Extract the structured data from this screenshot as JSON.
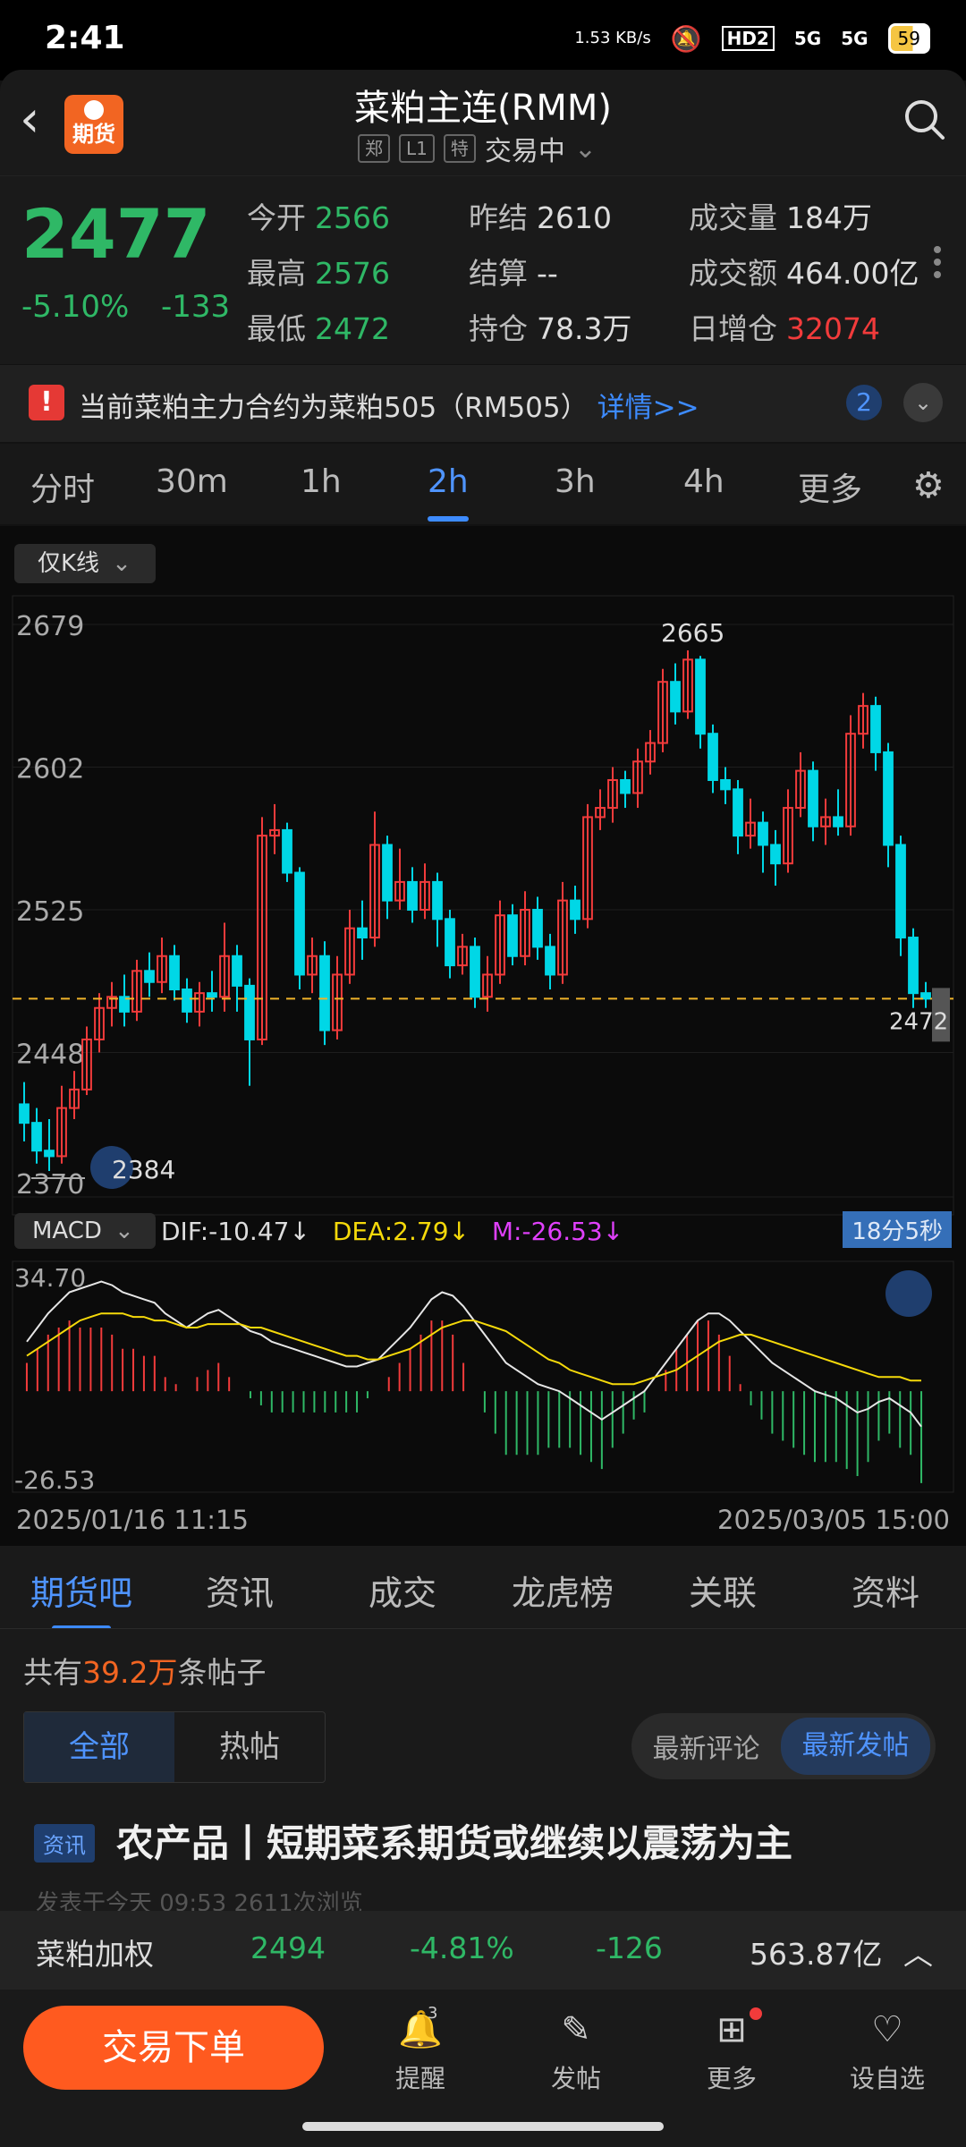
{
  "status_bar": {
    "time": "2:41",
    "net_speed": "1.53 KB/s",
    "hd": "HD2",
    "sig1": "5G",
    "sig2": "5G",
    "battery": "59"
  },
  "header": {
    "title": "菜粕主连(RMM)",
    "tag1": "郑",
    "tag2": "L1",
    "tag3": "特",
    "status": "交易中",
    "logo_text": "期货"
  },
  "quote": {
    "price": "2477",
    "pct": "-5.10%",
    "change": "-133",
    "open_label": "今开",
    "open": "2566",
    "prev_label": "昨结",
    "prev": "2610",
    "vol_label": "成交量",
    "vol": "184万",
    "high_label": "最高",
    "high": "2576",
    "settle_label": "结算",
    "settle": "--",
    "amount_label": "成交额",
    "amount": "464.00亿",
    "low_label": "最低",
    "low": "2472",
    "oi_label": "持仓",
    "oi": "78.3万",
    "oi_inc_label": "日增仓",
    "oi_inc": "32074"
  },
  "notice": {
    "text": "当前菜粕主力合约为菜粕505（RM505）",
    "link": "详情>>",
    "count": "2"
  },
  "periods": [
    "分时",
    "30m",
    "1h",
    "2h",
    "3h",
    "4h",
    "更多"
  ],
  "active_period": "2h",
  "chart_controls": {
    "kline_select": "仅K线",
    "macd_select": "MACD",
    "time_badge": "18分5秒",
    "start_date": "2025/01/16 11:15",
    "end_date": "2025/03/05 15:00"
  },
  "macd": {
    "dif": "DIF:-10.47↓",
    "dea": "DEA:2.79↓",
    "m": "M:-26.53↓"
  },
  "section_tabs": [
    "期货吧",
    "资讯",
    "成交",
    "龙虎榜",
    "关联",
    "资料"
  ],
  "posts": {
    "count_prefix": "共有",
    "count": "39.2万",
    "count_suffix": "条帖子",
    "seg_all": "全部",
    "seg_hot": "热帖",
    "sort_comment": "最新评论",
    "sort_post": "最新发帖"
  },
  "news": {
    "tag": "资讯",
    "title": "农产品丨短期菜系期货或继续以震荡为主",
    "meta": "发表于今天 09:53    2611次浏览"
  },
  "weighted": {
    "name": "菜粕加权",
    "price": "2494",
    "pct": "-4.81%",
    "change": "-126",
    "amount": "563.87亿"
  },
  "bottom": {
    "trade": "交易下单",
    "remind": "提醒",
    "remind_badge": "3",
    "post": "发帖",
    "more": "更多",
    "watch": "设自选"
  },
  "colors": {
    "up": "#f23b3b",
    "down": "#00d7e6",
    "accent": "#3d8bff",
    "orange": "#ff5a1f",
    "price_line": "#f0b429"
  },
  "chart_data": {
    "type": "candlestick",
    "yticks": [
      2679,
      2602,
      2525,
      2448,
      2370
    ],
    "ylim": [
      2370,
      2679
    ],
    "high_label": "2665",
    "low_label": "2384",
    "last_label": "2472",
    "current_price_line": 2477,
    "candles": [
      [
        2420,
        2410,
        2432,
        2400
      ],
      [
        2410,
        2395,
        2418,
        2388
      ],
      [
        2395,
        2392,
        2412,
        2384
      ],
      [
        2392,
        2418,
        2430,
        2388
      ],
      [
        2418,
        2428,
        2438,
        2412
      ],
      [
        2428,
        2455,
        2462,
        2425
      ],
      [
        2455,
        2472,
        2480,
        2448
      ],
      [
        2472,
        2478,
        2486,
        2462
      ],
      [
        2478,
        2470,
        2490,
        2462
      ],
      [
        2470,
        2492,
        2498,
        2465
      ],
      [
        2492,
        2486,
        2502,
        2478
      ],
      [
        2486,
        2500,
        2510,
        2480
      ],
      [
        2500,
        2482,
        2506,
        2476
      ],
      [
        2482,
        2470,
        2488,
        2464
      ],
      [
        2470,
        2480,
        2486,
        2462
      ],
      [
        2480,
        2478,
        2492,
        2470
      ],
      [
        2478,
        2500,
        2518,
        2470
      ],
      [
        2500,
        2484,
        2506,
        2470
      ],
      [
        2484,
        2455,
        2488,
        2430
      ],
      [
        2455,
        2565,
        2575,
        2452
      ],
      [
        2565,
        2568,
        2582,
        2555
      ],
      [
        2568,
        2545,
        2572,
        2540
      ],
      [
        2545,
        2490,
        2548,
        2482
      ],
      [
        2490,
        2500,
        2510,
        2480
      ],
      [
        2500,
        2460,
        2508,
        2452
      ],
      [
        2460,
        2490,
        2500,
        2455
      ],
      [
        2490,
        2515,
        2525,
        2485
      ],
      [
        2515,
        2510,
        2530,
        2498
      ],
      [
        2510,
        2560,
        2578,
        2505
      ],
      [
        2560,
        2530,
        2565,
        2520
      ],
      [
        2530,
        2540,
        2558,
        2525
      ],
      [
        2540,
        2525,
        2548,
        2518
      ],
      [
        2525,
        2540,
        2550,
        2520
      ],
      [
        2540,
        2520,
        2545,
        2505
      ],
      [
        2520,
        2495,
        2525,
        2488
      ],
      [
        2495,
        2505,
        2512,
        2490
      ],
      [
        2505,
        2478,
        2510,
        2472
      ],
      [
        2478,
        2490,
        2500,
        2470
      ],
      [
        2490,
        2522,
        2530,
        2485
      ],
      [
        2522,
        2500,
        2528,
        2495
      ],
      [
        2500,
        2525,
        2535,
        2495
      ],
      [
        2525,
        2505,
        2532,
        2498
      ],
      [
        2505,
        2490,
        2512,
        2482
      ],
      [
        2490,
        2530,
        2540,
        2485
      ],
      [
        2530,
        2520,
        2538,
        2512
      ],
      [
        2520,
        2575,
        2582,
        2515
      ],
      [
        2575,
        2580,
        2590,
        2568
      ],
      [
        2580,
        2595,
        2602,
        2572
      ],
      [
        2595,
        2588,
        2600,
        2580
      ],
      [
        2588,
        2605,
        2612,
        2580
      ],
      [
        2605,
        2615,
        2622,
        2598
      ],
      [
        2615,
        2648,
        2655,
        2610
      ],
      [
        2648,
        2632,
        2658,
        2625
      ],
      [
        2632,
        2660,
        2665,
        2628
      ],
      [
        2660,
        2620,
        2662,
        2612
      ],
      [
        2620,
        2595,
        2625,
        2588
      ],
      [
        2595,
        2590,
        2602,
        2582
      ],
      [
        2590,
        2565,
        2595,
        2555
      ],
      [
        2565,
        2572,
        2585,
        2558
      ],
      [
        2572,
        2560,
        2578,
        2545
      ],
      [
        2560,
        2550,
        2568,
        2538
      ],
      [
        2550,
        2580,
        2590,
        2545
      ],
      [
        2580,
        2600,
        2610,
        2575
      ],
      [
        2600,
        2570,
        2605,
        2562
      ],
      [
        2570,
        2575,
        2585,
        2560
      ],
      [
        2575,
        2570,
        2590,
        2565
      ],
      [
        2570,
        2620,
        2630,
        2565
      ],
      [
        2620,
        2635,
        2642,
        2612
      ],
      [
        2635,
        2610,
        2640,
        2600
      ],
      [
        2610,
        2560,
        2615,
        2548
      ],
      [
        2560,
        2510,
        2565,
        2500
      ],
      [
        2510,
        2480,
        2515,
        2472
      ],
      [
        2480,
        2477,
        2486,
        2472
      ]
    ],
    "macd_ylim": [
      -26.53,
      34.7
    ],
    "macd_yticks": [
      "34.70",
      "-26.53"
    ],
    "dif": [
      14,
      18,
      22,
      25,
      28,
      29,
      30,
      31,
      30,
      28,
      27,
      26,
      25,
      22,
      20,
      18,
      20,
      22,
      23,
      21,
      19,
      17,
      16,
      14,
      13,
      12,
      11,
      10,
      9,
      8,
      7,
      7,
      8,
      9,
      12,
      15,
      18,
      22,
      26,
      28,
      27,
      24,
      20,
      16,
      12,
      8,
      6,
      4,
      2,
      1,
      0,
      -2,
      -4,
      -6,
      -8,
      -6,
      -4,
      -2,
      0,
      4,
      8,
      12,
      16,
      20,
      22,
      22,
      20,
      17,
      14,
      11,
      8,
      6,
      4,
      2,
      0,
      -1,
      -2,
      -4,
      -6,
      -5,
      -3,
      -2,
      -4,
      -6,
      -10
    ],
    "dea": [
      10,
      12,
      14,
      16,
      18,
      20,
      21,
      22,
      22,
      22,
      21,
      21,
      20,
      20,
      19,
      18,
      18,
      19,
      19,
      19,
      19,
      18,
      18,
      17,
      16,
      15,
      14,
      13,
      12,
      11,
      10,
      10,
      9,
      9,
      10,
      11,
      12,
      14,
      16,
      18,
      19,
      20,
      20,
      19,
      18,
      17,
      15,
      13,
      11,
      9,
      8,
      6,
      5,
      4,
      3,
      2,
      2,
      2,
      3,
      4,
      5,
      6,
      8,
      10,
      12,
      14,
      15,
      16,
      16,
      15,
      14,
      13,
      12,
      11,
      10,
      9,
      8,
      7,
      6,
      5,
      4,
      4,
      4,
      3,
      3
    ],
    "hist": [
      8,
      12,
      16,
      18,
      20,
      18,
      18,
      18,
      16,
      12,
      12,
      10,
      10,
      4,
      2,
      0,
      4,
      6,
      8,
      4,
      0,
      -2,
      -4,
      -6,
      -6,
      -6,
      -6,
      -6,
      -6,
      -6,
      -6,
      -6,
      -2,
      0,
      4,
      8,
      12,
      16,
      20,
      20,
      16,
      8,
      0,
      -6,
      -12,
      -18,
      -18,
      -18,
      -18,
      -16,
      -16,
      -16,
      -18,
      -20,
      -22,
      -16,
      -12,
      -8,
      -6,
      0,
      6,
      12,
      16,
      20,
      20,
      16,
      10,
      2,
      -4,
      -8,
      -12,
      -14,
      -16,
      -18,
      -20,
      -20,
      -20,
      -22,
      -24,
      -20,
      -14,
      -12,
      -16,
      -18,
      -26
    ]
  }
}
